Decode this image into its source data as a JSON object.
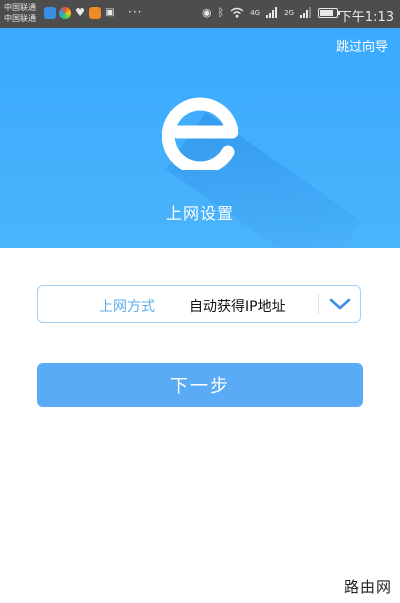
{
  "status_bar": {
    "carrier_1": "中国联通",
    "carrier_2": "中国联通",
    "ellipsis": "···",
    "network_1": "4G",
    "network_2": "2G",
    "time": "下午1:13",
    "battery_level": 0.8,
    "notification_icons": [
      "app-icon-blue",
      "app-icon-colorful",
      "app-icon-heart",
      "app-icon-orange",
      "app-icon-lock"
    ]
  },
  "header": {
    "skip_label": "跳过向导",
    "title": "上网设置",
    "logo": "e-logo"
  },
  "form": {
    "connection_label": "上网方式",
    "connection_value": "自动获得IP地址"
  },
  "next_label": "下一步",
  "watermark": "路由网",
  "colors": {
    "header_blue": "#3aa9ff",
    "button_blue": "#5aabf5",
    "label_blue": "#5aaeea"
  }
}
